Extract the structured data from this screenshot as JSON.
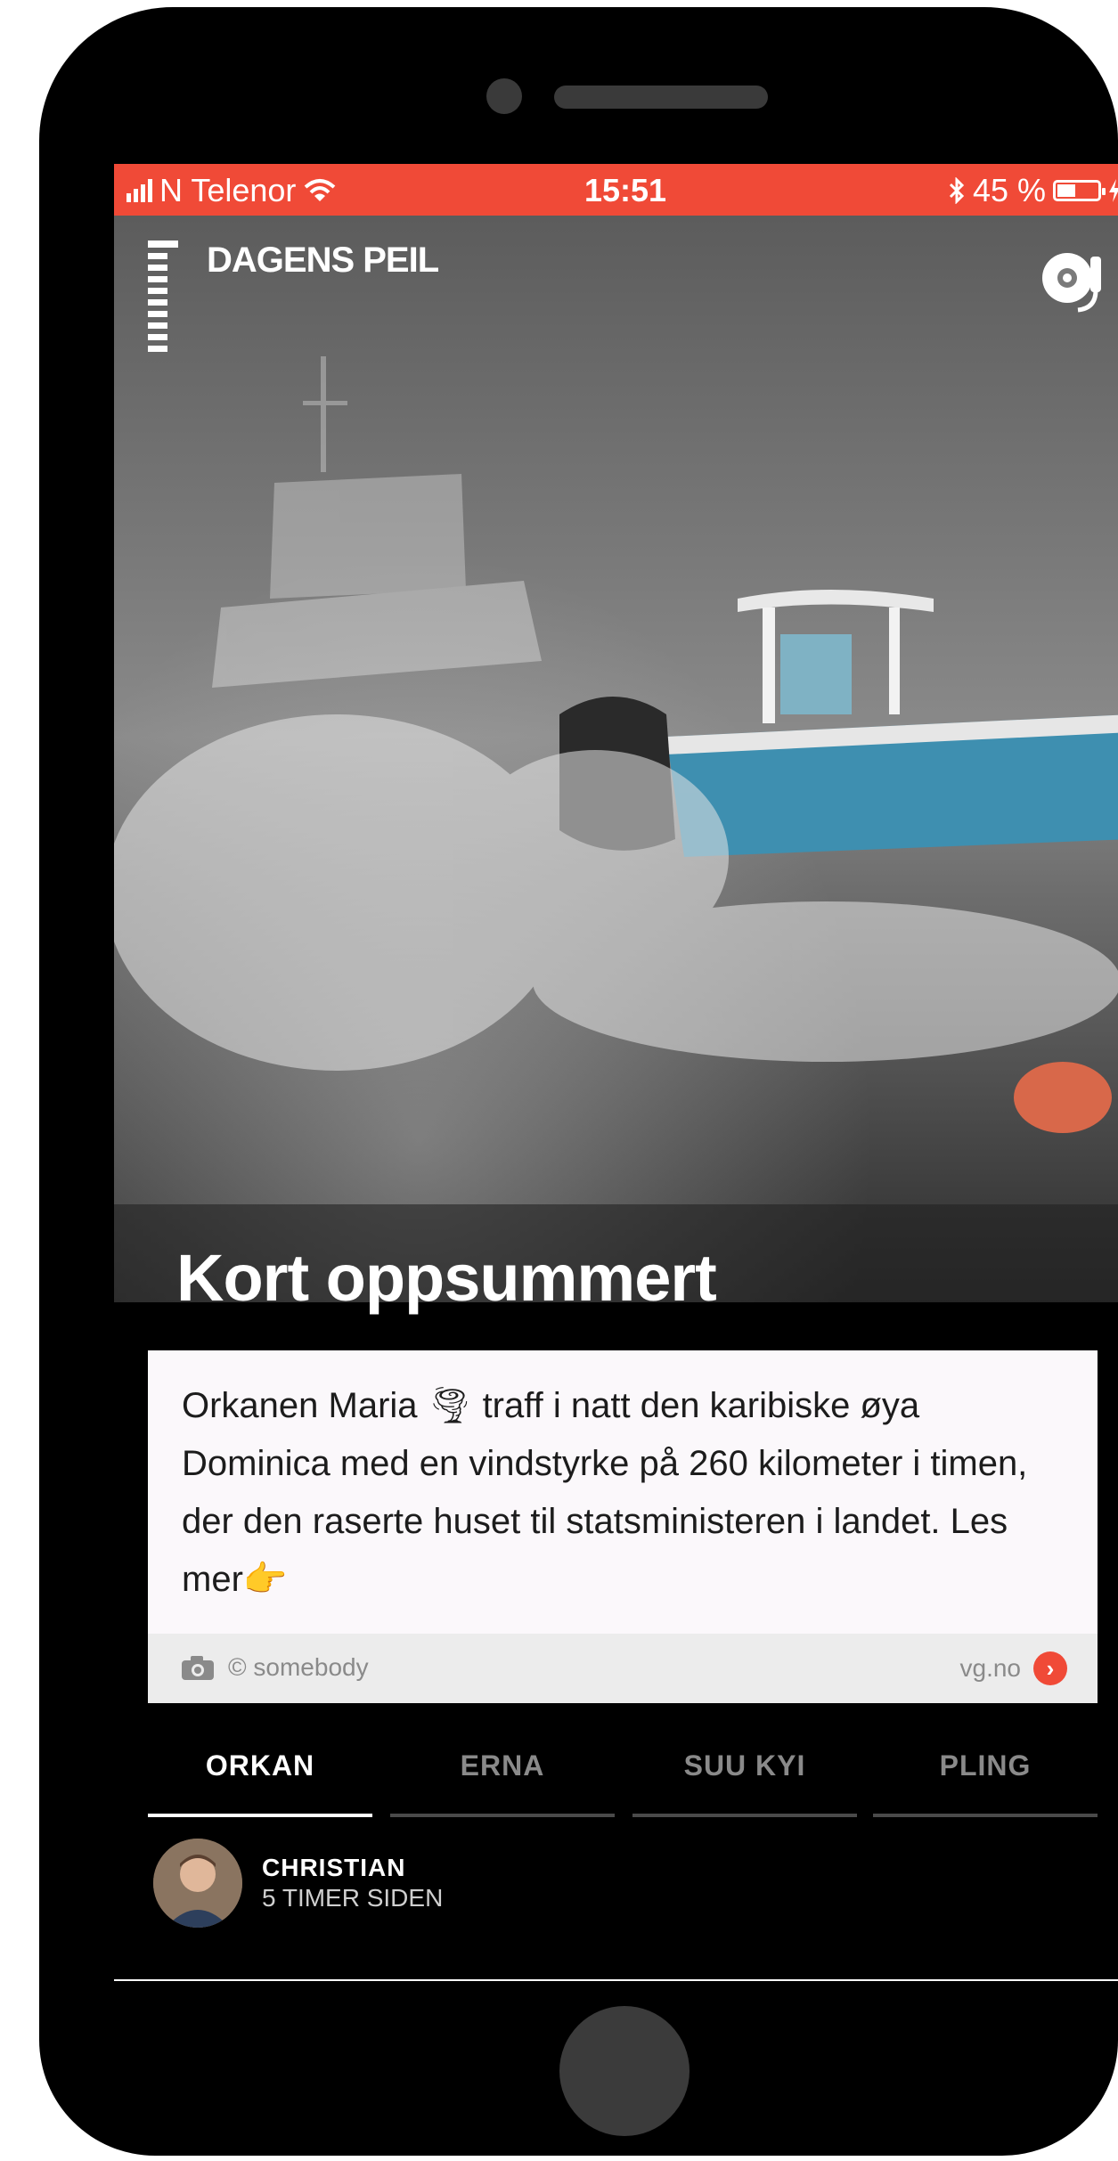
{
  "status_bar": {
    "carrier": "N Telenor",
    "time": "15:51",
    "battery": "45 %",
    "battery_level": 0.45,
    "icons": [
      "signal-icon",
      "wifi-icon",
      "bluetooth-icon",
      "battery-icon",
      "charging-icon"
    ]
  },
  "header": {
    "title": "DAGENS PEIL",
    "profile_icon": "headset-profile-icon"
  },
  "hero": {
    "title": "Kort oppsummert"
  },
  "card": {
    "text_part1": "Orkanen Maria ",
    "emoji_tornado": "🌪",
    "text_part2": " traff i natt den karibiske øya Dominica med en vindstyrke på 260 kilometer i timen, der den raserte huset til statsministeren i landet. Les mer",
    "emoji_point": "👉",
    "credit": "© somebody",
    "source": "vg.no",
    "source_chevron": "›"
  },
  "tabs": [
    {
      "label": "ORKAN",
      "active": true
    },
    {
      "label": "ERNA",
      "active": false
    },
    {
      "label": "SUU KYI",
      "active": false
    },
    {
      "label": "PLING",
      "active": false
    }
  ],
  "author": {
    "name": "CHRISTIAN",
    "time": "5 TIMER SIDEN"
  },
  "colors": {
    "accent": "#f04a37",
    "background": "#000000",
    "card": "#fbf8fb"
  }
}
